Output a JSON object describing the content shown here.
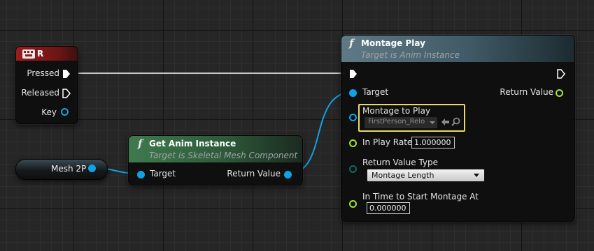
{
  "colors": {
    "object_pin": "#0fa3e6",
    "float_pin": "#a0e62a",
    "byte_pin": "#0a6e62",
    "exec_pin": "#ffffff",
    "input_event_header": "#8c1a1a",
    "function_header": "#2b5e3a",
    "selection_highlight": "#ead86a"
  },
  "input_event": {
    "title": "R",
    "icon": "keyboard-icon",
    "pins": {
      "pressed": "Pressed",
      "released": "Released",
      "key": "Key"
    }
  },
  "mesh_variable": {
    "label": "Mesh 2P"
  },
  "get_anim_instance": {
    "title": "Get Anim Instance",
    "subtitle": "Target is Skeletal Mesh Component",
    "icon": "function-icon",
    "target_label": "Target",
    "return_label": "Return Value"
  },
  "montage_play": {
    "title": "Montage Play",
    "subtitle": "Target is Anim Instance",
    "icon": "function-icon",
    "target_label": "Target",
    "return_label": "Return Value",
    "montage_to_play": {
      "label": "Montage to Play",
      "value": "FirstPerson_Relo"
    },
    "in_play_rate": {
      "label": "In Play Rate",
      "value": "1.000000"
    },
    "return_value_type": {
      "label": "Return Value Type",
      "value": "Montage Length"
    },
    "in_time_to_start": {
      "label": "In Time to Start Montage At",
      "value": "0.000000"
    }
  }
}
